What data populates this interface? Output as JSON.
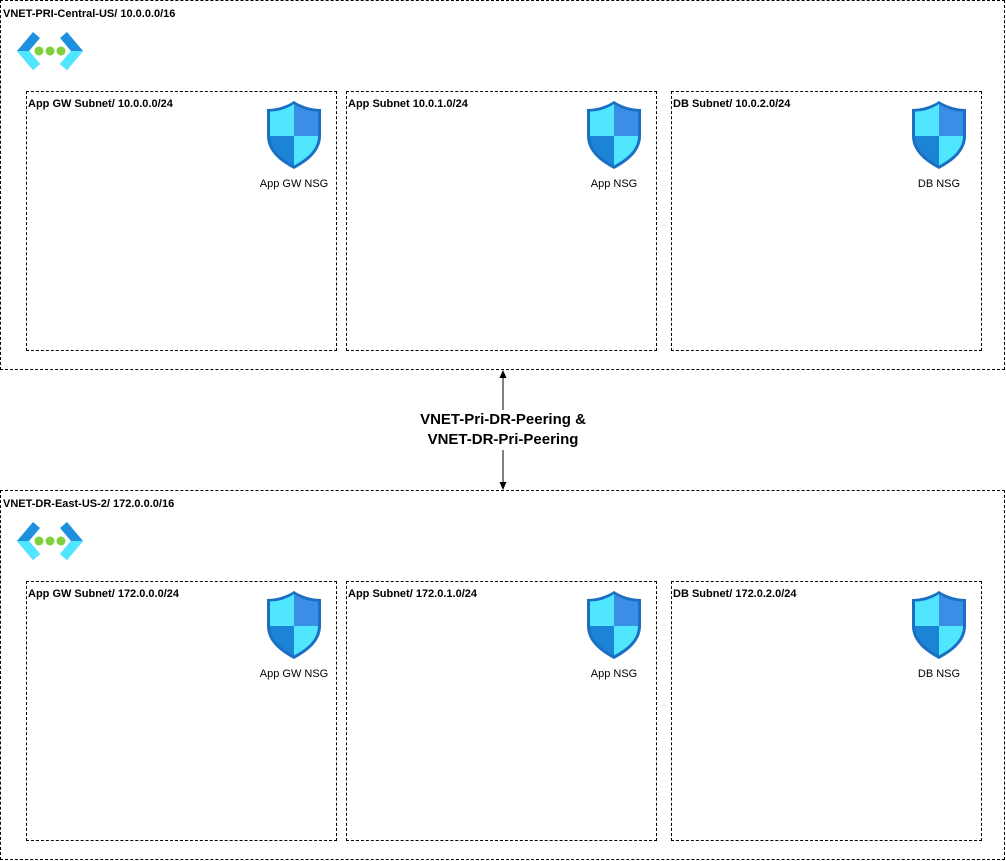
{
  "vnets": [
    {
      "label": "VNET-PRI-Central-US/ 10.0.0.0/16",
      "icon": "virtual-network-icon",
      "subnets": [
        {
          "label": "App GW Subnet/ 10.0.0.0/24",
          "nsg": "App GW NSG",
          "icon": "nsg-shield-icon"
        },
        {
          "label": "App Subnet 10.0.1.0/24",
          "nsg": "App NSG",
          "icon": "nsg-shield-icon"
        },
        {
          "label": "DB Subnet/ 10.0.2.0/24",
          "nsg": "DB NSG",
          "icon": "nsg-shield-icon"
        }
      ]
    },
    {
      "label": "VNET-DR-East-US-2/ 172.0.0.0/16",
      "icon": "virtual-network-icon",
      "subnets": [
        {
          "label": "App GW Subnet/ 172.0.0.0/24",
          "nsg": "App GW NSG",
          "icon": "nsg-shield-icon"
        },
        {
          "label": "App Subnet/ 172.0.1.0/24",
          "nsg": "App NSG",
          "icon": "nsg-shield-icon"
        },
        {
          "label": "DB Subnet/ 172.0.2.0/24",
          "nsg": "DB NSG",
          "icon": "nsg-shield-icon"
        }
      ]
    }
  ],
  "peering": {
    "line1": "VNET-Pri-DR-Peering &",
    "line2": "VNET-DR-Pri-Peering"
  },
  "colors": {
    "shield_light": "#50e6ff",
    "shield_dark": "#1b84d6",
    "shield_mid": "#3aa0f0",
    "vnet_chevron": "#1e90e0",
    "vnet_chevron_light": "#50e6ff",
    "vnet_dots": "#7fd13b"
  }
}
